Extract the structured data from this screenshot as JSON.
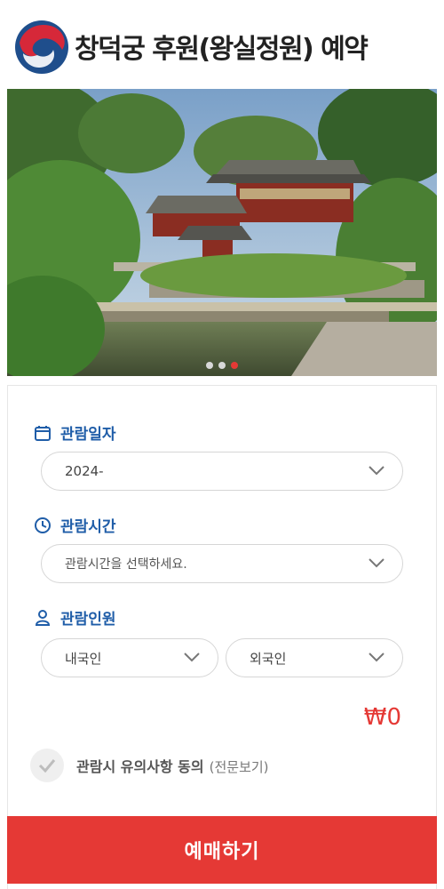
{
  "header": {
    "title": "창덕궁 후원(왕실정원) 예약"
  },
  "hero": {
    "image_alt": "창덕궁 후원 전경",
    "slides": 3,
    "active_slide": 3
  },
  "form": {
    "date": {
      "label": "관람일자",
      "value": "2024-"
    },
    "time": {
      "label": "관람시간",
      "placeholder": "관람시간을 선택하세요."
    },
    "people": {
      "label": "관람인원",
      "domestic": "내국인",
      "foreign": "외국인"
    }
  },
  "price": "₩0",
  "agreement": {
    "label": "관람시 유의사항 동의",
    "link": "(전문보기)"
  },
  "reserve_button": "예매하기",
  "colors": {
    "accent": "#1f5da8",
    "primary": "#e53935"
  }
}
